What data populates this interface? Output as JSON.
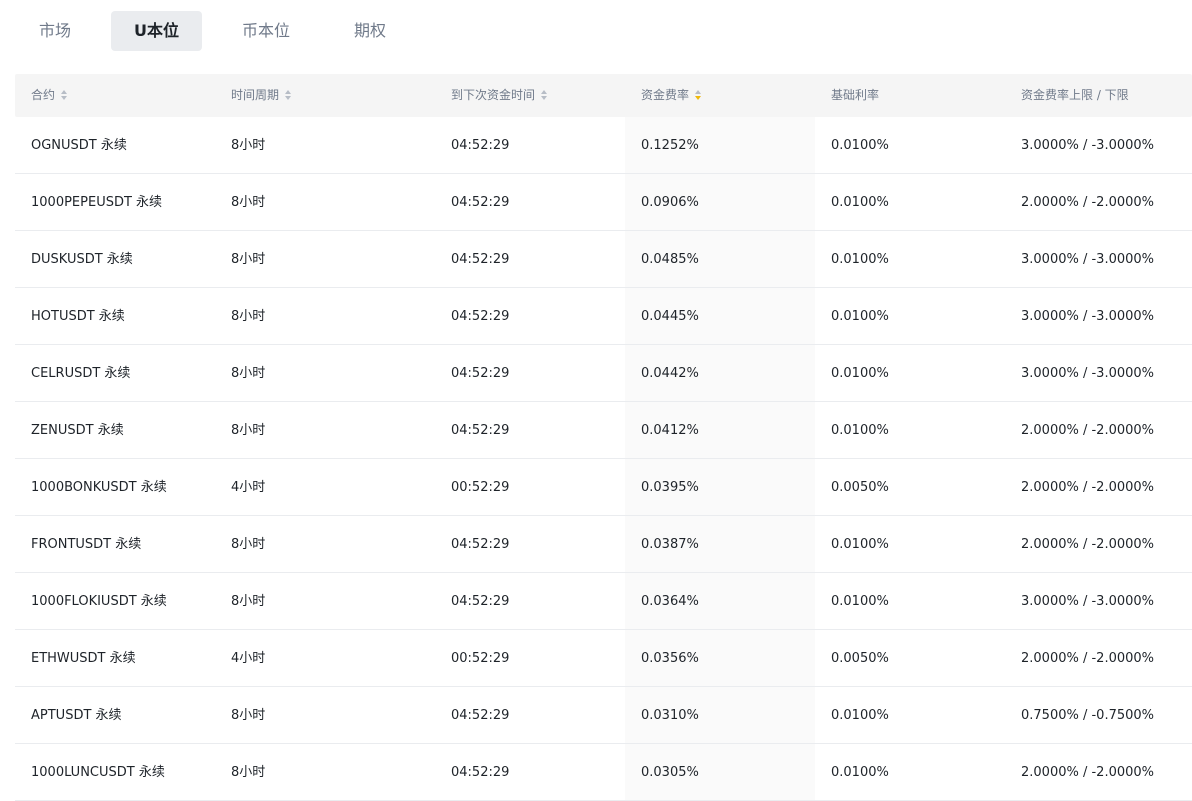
{
  "tabs": [
    {
      "label": "市场",
      "active": false
    },
    {
      "label": "U本位",
      "active": true
    },
    {
      "label": "币本位",
      "active": false
    },
    {
      "label": "期权",
      "active": false
    }
  ],
  "columns": [
    {
      "label": "合约",
      "sortable": true,
      "sort_active": false
    },
    {
      "label": "时间周期",
      "sortable": true,
      "sort_active": false
    },
    {
      "label": "到下次资金时间",
      "sortable": true,
      "sort_active": false
    },
    {
      "label": "资金费率",
      "sortable": true,
      "sort_active": true
    },
    {
      "label": "基础利率",
      "sortable": false,
      "sort_active": false
    },
    {
      "label": "资金费率上限 / 下限",
      "sortable": false,
      "sort_active": false
    }
  ],
  "colors": {
    "sort_active": "#f0b90b",
    "sort_inactive": "#b7bdc6"
  },
  "rows": [
    {
      "contract": "OGNUSDT 永续",
      "period": "8小时",
      "next": "04:52:29",
      "rate": "0.1252%",
      "base": "0.0100%",
      "limits": "3.0000% / -3.0000%"
    },
    {
      "contract": "1000PEPEUSDT 永续",
      "period": "8小时",
      "next": "04:52:29",
      "rate": "0.0906%",
      "base": "0.0100%",
      "limits": "2.0000% / -2.0000%"
    },
    {
      "contract": "DUSKUSDT 永续",
      "period": "8小时",
      "next": "04:52:29",
      "rate": "0.0485%",
      "base": "0.0100%",
      "limits": "3.0000% / -3.0000%"
    },
    {
      "contract": "HOTUSDT 永续",
      "period": "8小时",
      "next": "04:52:29",
      "rate": "0.0445%",
      "base": "0.0100%",
      "limits": "3.0000% / -3.0000%"
    },
    {
      "contract": "CELRUSDT 永续",
      "period": "8小时",
      "next": "04:52:29",
      "rate": "0.0442%",
      "base": "0.0100%",
      "limits": "3.0000% / -3.0000%"
    },
    {
      "contract": "ZENUSDT 永续",
      "period": "8小时",
      "next": "04:52:29",
      "rate": "0.0412%",
      "base": "0.0100%",
      "limits": "2.0000% / -2.0000%"
    },
    {
      "contract": "1000BONKUSDT 永续",
      "period": "4小时",
      "next": "00:52:29",
      "rate": "0.0395%",
      "base": "0.0050%",
      "limits": "2.0000% / -2.0000%"
    },
    {
      "contract": "FRONTUSDT 永续",
      "period": "8小时",
      "next": "04:52:29",
      "rate": "0.0387%",
      "base": "0.0100%",
      "limits": "2.0000% / -2.0000%"
    },
    {
      "contract": "1000FLOKIUSDT 永续",
      "period": "8小时",
      "next": "04:52:29",
      "rate": "0.0364%",
      "base": "0.0100%",
      "limits": "3.0000% / -3.0000%"
    },
    {
      "contract": "ETHWUSDT 永续",
      "period": "4小时",
      "next": "00:52:29",
      "rate": "0.0356%",
      "base": "0.0050%",
      "limits": "2.0000% / -2.0000%"
    },
    {
      "contract": "APTUSDT 永续",
      "period": "8小时",
      "next": "04:52:29",
      "rate": "0.0310%",
      "base": "0.0100%",
      "limits": "0.7500% / -0.7500%"
    },
    {
      "contract": "1000LUNCUSDT 永续",
      "period": "8小时",
      "next": "04:52:29",
      "rate": "0.0305%",
      "base": "0.0100%",
      "limits": "2.0000% / -2.0000%"
    }
  ]
}
